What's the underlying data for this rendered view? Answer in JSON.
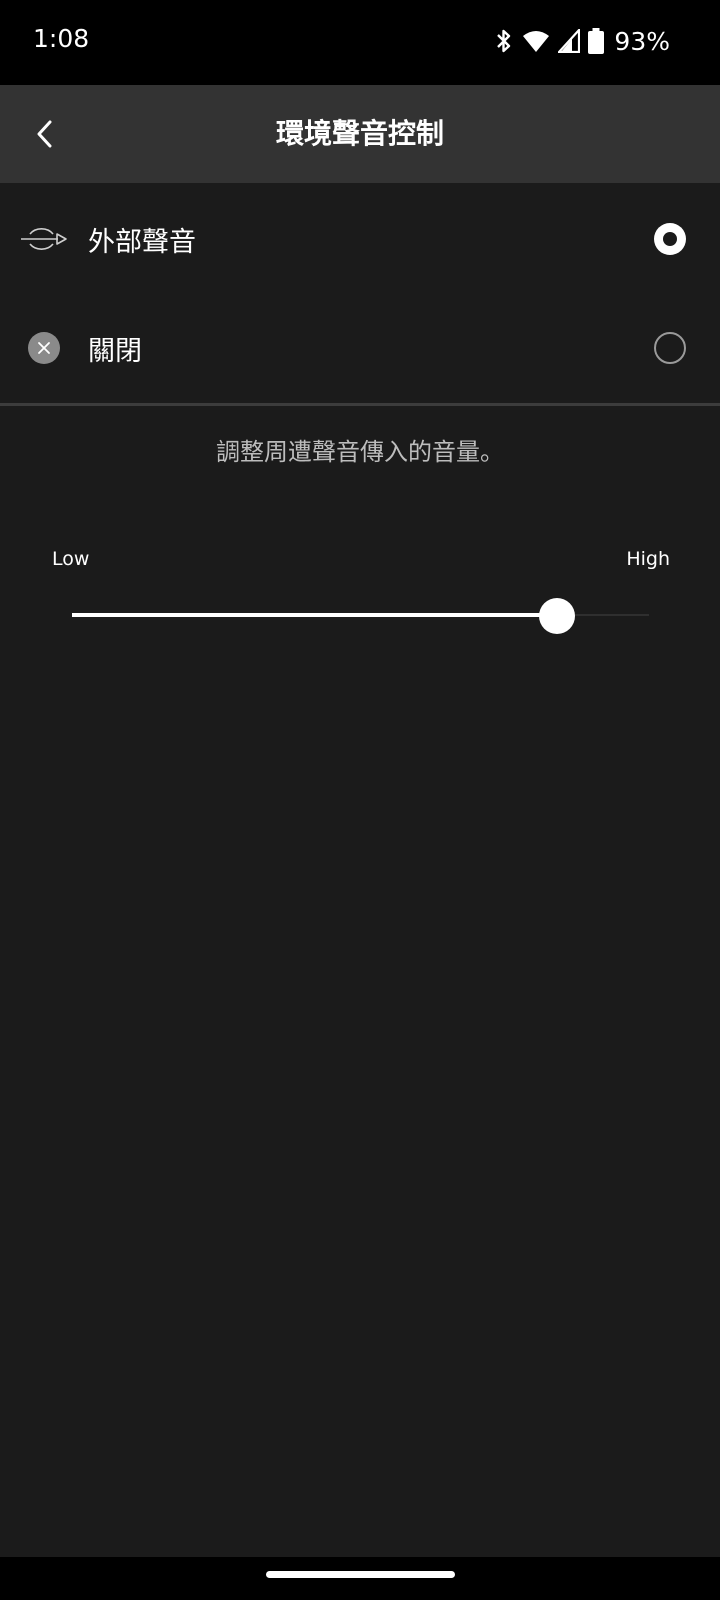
{
  "status": {
    "time": "1:08",
    "battery": "93%",
    "icons": [
      "bluetooth-icon",
      "wifi-icon",
      "cell-signal-icon",
      "battery-icon"
    ]
  },
  "header": {
    "title": "環境聲音控制",
    "back_icon": "chevron-left-icon"
  },
  "options": [
    {
      "label": "外部聲音",
      "icon": "ambient-sound-icon",
      "selected": true
    },
    {
      "label": "關閉",
      "icon": "close-circle-icon",
      "selected": false
    }
  ],
  "description": "調整周遭聲音傳入的音量。",
  "slider": {
    "low_label": "Low",
    "high_label": "High",
    "value": 0.84
  },
  "colors": {
    "background": "#1b1b1b",
    "app_bar": "#333333",
    "accent": "#ffffff"
  }
}
